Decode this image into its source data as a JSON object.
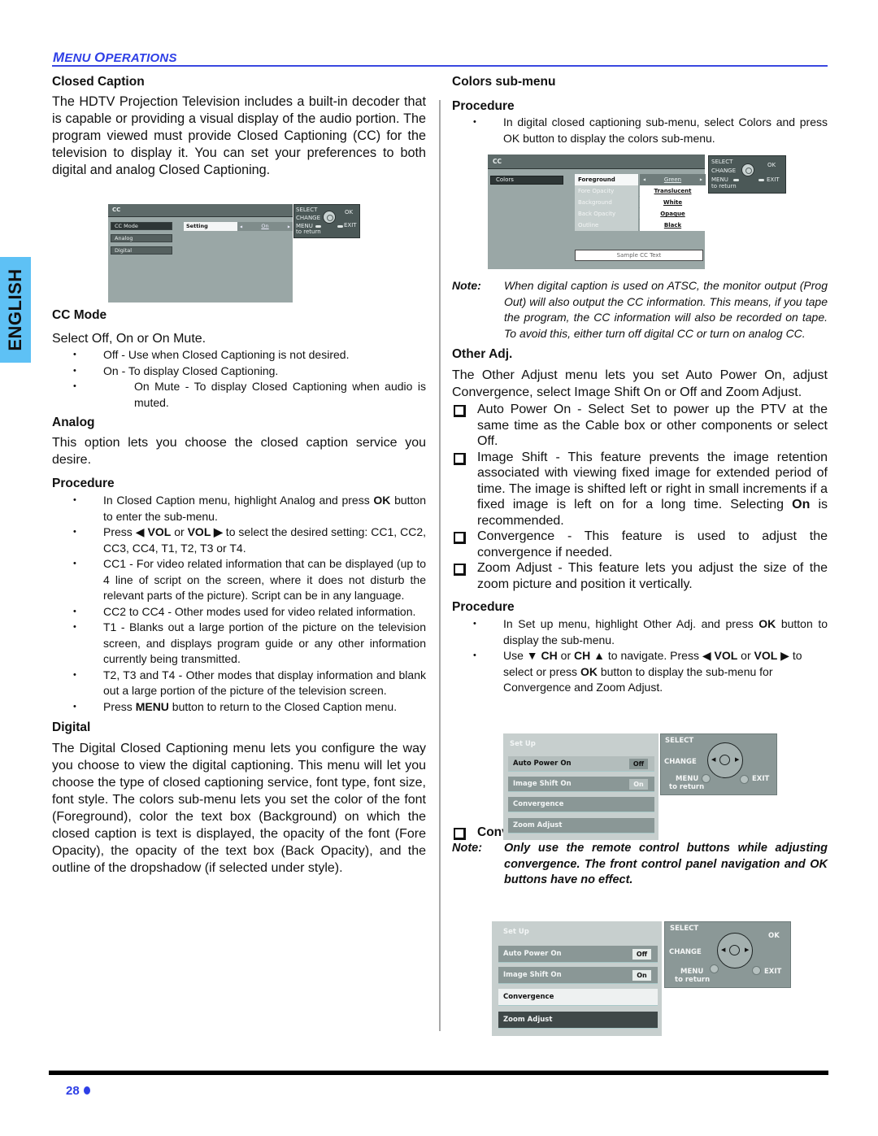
{
  "header": {
    "section_title_first": "M",
    "section_title_rest1": "ENU ",
    "section_title_second": "O",
    "section_title_rest2": "PERATIONS",
    "section_title_full": "MENU OPERATIONS"
  },
  "language_tab": "ENGLISH",
  "left": {
    "closed_caption": {
      "heading": "Closed Caption",
      "body": "The HDTV Projection Television includes a built-in decoder that is capable or providing a visual display of the audio portion. The program viewed must provide Closed Captioning (CC) for the television to display it. You can set your preferences to both digital and analog Closed Captioning."
    },
    "cc_menu": {
      "title": "CC",
      "items": [
        "CC Mode",
        "Analog",
        "Digital"
      ],
      "active_item": "CC Mode",
      "setting_label": "Setting",
      "setting_value": "On",
      "remote": {
        "select": "SELECT",
        "change": "CHANGE",
        "ok": "OK",
        "menu": "MENU",
        "exit": "EXIT",
        "to_return": "to return"
      }
    },
    "cc_mode": {
      "heading": "CC Mode",
      "intro": "Select Off, On or On Mute.",
      "bullets": [
        "Off - Use when Closed Captioning is not desired.",
        "On - To display Closed Captioning.",
        "On Mute - To display Closed Captioning when audio is muted."
      ]
    },
    "analog": {
      "heading": "Analog",
      "body": "This option lets you choose the closed caption service you desire."
    },
    "procedure": {
      "heading": "Procedure",
      "bullets": [
        {
          "pre": "In Closed Caption menu, highlight Analog and press ",
          "b1": "OK",
          "post": " button to enter the sub-menu."
        },
        {
          "pre": "Press ◀ ",
          "b1": "VOL",
          "mid": " or ",
          "b2": "VOL ▶",
          "post": " to select the desired setting: CC1, CC2, CC3, CC4, T1, T2, T3 or T4."
        },
        {
          "text": "CC1 - For video related information that can be displayed (up to 4 line of script on the screen, where it does not disturb the relevant parts of the picture). Script can be in any language."
        },
        {
          "text": "CC2 to CC4 - Other modes used for video related information."
        },
        {
          "text": "T1 - Blanks out a large portion of the picture on the television screen, and displays program guide or any other information currently being transmitted."
        },
        {
          "text": "T2, T3 and T4 - Other modes that display information and blank out a large portion of the picture of the television screen."
        },
        {
          "pre": "Press ",
          "b1": "MENU",
          "post": " button to return to the Closed Caption menu."
        }
      ]
    },
    "digital": {
      "heading": "Digital",
      "body": "The Digital Closed Captioning menu lets you configure the way you choose to view the digital captioning. This menu will let you choose the type of closed captioning service, font type, font size, font style. The colors sub-menu lets you set the color of the font (Foreground), color the text box (Background) on which the closed caption is text is displayed, the opacity of the font (Fore Opacity), the opacity of the text box (Back Opacity), and the outline of the dropshadow (if selected under style)."
    }
  },
  "right": {
    "colors_submenu": {
      "heading": "Colors sub-menu",
      "procedure_heading": "Procedure",
      "bullets": [
        "In digital closed captioning sub-menu, select Colors and press OK button to display the colors sub-menu."
      ]
    },
    "colors_menu": {
      "title": "CC",
      "left_item": "Colors",
      "rows": [
        {
          "label": "Foreground",
          "value": "Green",
          "active": true
        },
        {
          "label": "Fore Opacity",
          "value": "Translucent",
          "active": false
        },
        {
          "label": "Background",
          "value": "White",
          "active": false
        },
        {
          "label": "Back Opacity",
          "value": "Opaque",
          "active": false
        },
        {
          "label": "Outline",
          "value": "Black",
          "active": false
        }
      ],
      "sample_text": "Sample CC Text",
      "remote": {
        "select": "SELECT",
        "change": "CHANGE",
        "ok": "OK",
        "menu": "MENU",
        "exit": "EXIT",
        "to_return": "to return"
      }
    },
    "note1": {
      "label": "Note:",
      "text": "When digital caption is used on ATSC, the monitor output (Prog Out) will also output the CC information. This means, if you tape the program, the CC information will also be recorded on tape. To avoid this, either turn off digital CC or turn on analog CC."
    },
    "other_adj": {
      "heading": "Other Adj.",
      "body": "The Other Adjust menu lets you set Auto Power On, adjust Convergence, select Image Shift On or Off and Zoom Adjust.",
      "checks": [
        {
          "text": "Auto Power On - Select Set to power up the PTV at the same time as the Cable box or other components or select Off."
        },
        {
          "pre": "Image Shift - This feature prevents the image retention associated with viewing fixed image for extended period of time. The image is shifted left or right in small increments if a fixed image is left on for a long time. Selecting ",
          "b1": "On",
          "post": " is recommended."
        },
        {
          "text": "Convergence - This feature is used to adjust the convergence if needed."
        },
        {
          "text": "Zoom Adjust - This feature lets you adjust the size of the zoom picture and position it vertically."
        }
      ]
    },
    "procedure2": {
      "heading": "Procedure",
      "bullets": [
        {
          "pre": "In Set up menu, highlight Other Adj. and press ",
          "b1": "OK",
          "post": " button to display the sub-menu."
        },
        {
          "pre": "Use ▼ ",
          "b1": "CH",
          "mid": " or ",
          "b2": "CH",
          "mid2": " ▲ to navigate. Press ◀ ",
          "b3": "VOL",
          "mid3": " or ",
          "b4": "VOL",
          "mid4": " ▶ to select or press ",
          "b5": "OK",
          "post": " button to display the sub-menu for Convergence and Zoom Adjust."
        }
      ]
    },
    "setup_menu_1": {
      "title": "Set Up",
      "items": [
        {
          "label": "Auto Power On",
          "badge": "Off"
        },
        {
          "label": "Image Shift On",
          "badge": "On"
        },
        {
          "label": "Convergence",
          "badge": ""
        },
        {
          "label": "Zoom Adjust",
          "badge": ""
        }
      ],
      "active_item": "Auto Power On",
      "remote": {
        "select": "SELECT",
        "change": "CHANGE",
        "menu": "MENU",
        "exit": "EXIT",
        "to_return": "to return"
      }
    },
    "convergence": {
      "heading": "Convergence",
      "note_label": "Note:",
      "note_text": "Only use the remote control buttons while adjusting convergence. The front control panel navigation and OK buttons have no effect."
    },
    "setup_menu_2": {
      "title": "Set Up",
      "items": [
        {
          "label": "Auto Power On",
          "badge": "Off"
        },
        {
          "label": "Image Shift On",
          "badge": "On"
        },
        {
          "label": "Convergence",
          "badge": ""
        },
        {
          "label": "Zoom Adjust",
          "badge": ""
        }
      ],
      "active_item": "Convergence",
      "selected_item": "Zoom Adjust",
      "remote": {
        "select": "SELECT",
        "change": "CHANGE",
        "ok": "OK",
        "menu": "MENU",
        "exit": "EXIT",
        "to_return": "to return"
      }
    }
  },
  "footer": {
    "page_number": "28"
  },
  "colors": {
    "accent_blue": "#2e3fe6",
    "lang_tab": "#5ec1f5",
    "osd_gray": "#9aa7a6"
  }
}
